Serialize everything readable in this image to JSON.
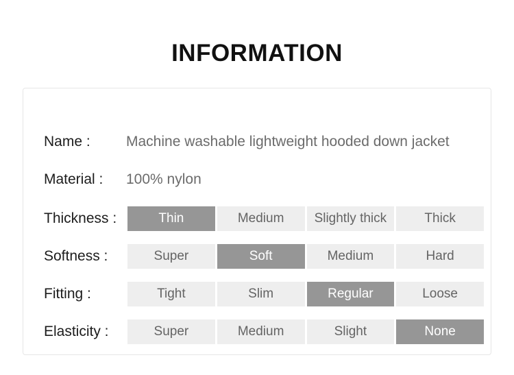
{
  "page": {
    "title": "INFORMATION",
    "background": "#ffffff",
    "card_border_color": "#e6e6e6",
    "selected_cell_color": "#969696",
    "unselected_cell_color": "#eeeeee",
    "selected_text_color": "#ffffff",
    "unselected_text_color": "#646464",
    "label_text_color": "#1c1c1c",
    "value_text_color": "#6b6b6b"
  },
  "info": {
    "text_rows": [
      {
        "label": "Name :",
        "value": "Machine washable lightweight hooded down jacket"
      },
      {
        "label": "Material :",
        "value": "100% nylon"
      }
    ],
    "option_rows": [
      {
        "label": "Thickness :",
        "selected_index": 0,
        "options": [
          {
            "label": "Thin",
            "selected": true
          },
          {
            "label": "Medium",
            "selected": false
          },
          {
            "label": "Slightly thick",
            "selected": false
          },
          {
            "label": "Thick",
            "selected": false
          }
        ]
      },
      {
        "label": "Softness :",
        "selected_index": 1,
        "options": [
          {
            "label": "Super",
            "selected": false
          },
          {
            "label": "Soft",
            "selected": true
          },
          {
            "label": "Medium",
            "selected": false
          },
          {
            "label": "Hard",
            "selected": false
          }
        ]
      },
      {
        "label": "Fitting :",
        "selected_index": 2,
        "options": [
          {
            "label": "Tight",
            "selected": false
          },
          {
            "label": "Slim",
            "selected": false
          },
          {
            "label": "Regular",
            "selected": true
          },
          {
            "label": "Loose",
            "selected": false
          }
        ]
      },
      {
        "label": "Elasticity :",
        "selected_index": 3,
        "options": [
          {
            "label": "Super",
            "selected": false
          },
          {
            "label": "Medium",
            "selected": false
          },
          {
            "label": "Slight",
            "selected": false
          },
          {
            "label": "None",
            "selected": true
          }
        ]
      }
    ]
  }
}
